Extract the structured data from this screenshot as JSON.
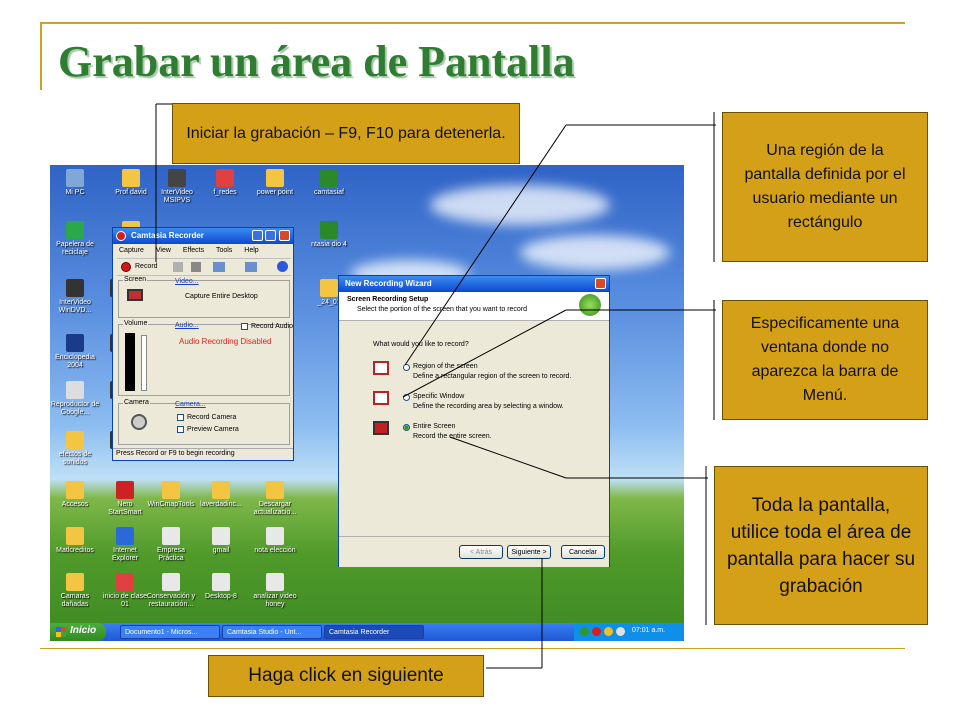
{
  "slide": {
    "title": "Grabar un área de Pantalla"
  },
  "callouts": {
    "start_recording": "Iniciar la grabación – F9, F10 para detenerla.",
    "region": "Una región de la pantalla definida por el usuario mediante un rectángulo",
    "window": "Especificamente una ventana donde no aparezca la barra de Menú.",
    "full_screen": "Toda la pantalla, utilice toda el área de pantalla para hacer su grabación",
    "click_next": "Haga click en siguiente"
  },
  "desktop_icons": [
    {
      "label": "Mi PC",
      "color": "#7fa7d8"
    },
    {
      "label": "Prof david",
      "color": "#f4c542"
    },
    {
      "label": "InterVideo MSIPVS",
      "color": "#444444"
    },
    {
      "label": "f_redes",
      "color": "#e04040"
    },
    {
      "label": "power point",
      "color": "#f4c542"
    },
    {
      "label": "camtasiaf",
      "color": "#2a8a2a"
    },
    {
      "label": "Papelera de reciclaje",
      "color": "#2aa84a"
    },
    {
      "label": "InterVideo WinDVD...",
      "color": "#333333"
    },
    {
      "label": "Enciclopedia 2004",
      "color": "#1a3a8a"
    },
    {
      "label": "Reproductor de Google...",
      "color": "#dddddd"
    },
    {
      "label": "efectos de sonidos",
      "color": "#f4c542"
    },
    {
      "label": "Accesos",
      "color": "#f4c542"
    },
    {
      "label": "Nero StartSmart",
      "color": "#cc2222"
    },
    {
      "label": "WinCmapTools",
      "color": "#f4c542"
    },
    {
      "label": "laverdadinc...",
      "color": "#f4c542"
    },
    {
      "label": "Descargar actualizacio...",
      "color": "#f4c542"
    },
    {
      "label": "Matlcreditos",
      "color": "#f4c542"
    },
    {
      "label": "Internet Explorer",
      "color": "#2a6ad8"
    },
    {
      "label": "Empresa Práctica",
      "color": "#e8e8e8"
    },
    {
      "label": "gmail",
      "color": "#e8e8e8"
    },
    {
      "label": "nota elección",
      "color": "#e8e8e8"
    },
    {
      "label": "Camaras dañadas",
      "color": "#f4c542"
    },
    {
      "label": "inicio de clase 01",
      "color": "#e04040"
    },
    {
      "label": "Conservación y restauración...",
      "color": "#e8e8e8"
    },
    {
      "label": "Desktop-8",
      "color": "#e8e8e8"
    },
    {
      "label": "analizar video honey",
      "color": "#e8e8e8"
    },
    {
      "label": "ntasia dio 4",
      "color": "#2a8a2a"
    },
    {
      "label": "_24_01",
      "color": "#f4c542"
    },
    {
      "label": "DVD",
      "color": "#333333"
    },
    {
      "label": "In Vi",
      "color": "#333333"
    },
    {
      "label": "Ne",
      "color": "#333333"
    },
    {
      "label": "f",
      "color": "#f4c542"
    },
    {
      "label": "A dir",
      "color": "#333333"
    }
  ],
  "recorder": {
    "title": "Camtasia Recorder",
    "menu": [
      "Capture",
      "View",
      "Effects",
      "Tools",
      "Help"
    ],
    "record_label": "Record",
    "screen_group": "Screen",
    "video_link": "Video...",
    "video_value": "Capture Entire Desktop",
    "volume_group": "Volume",
    "audio_link": "Audio...",
    "record_audio": "Record Audio",
    "audio_disabled": "Audio Recording Disabled",
    "camera_group": "Camera",
    "camera_link": "Camera...",
    "record_camera": "Record Camera",
    "preview_camera": "Preview Camera",
    "status": "Press Record or F9 to begin recording"
  },
  "wizard": {
    "title": "New Recording Wizard",
    "heading": "Screen Recording Setup",
    "subheading": "Select the portion of the screen that you want to record",
    "question": "What would you like to record?",
    "options": [
      {
        "label": "Region of the screen",
        "desc": "Define a rectangular region of the screen to record."
      },
      {
        "label": "Specific Window",
        "desc": "Define the recording area by selecting a window."
      },
      {
        "label": "Entire Screen",
        "desc": "Record the entire screen."
      }
    ],
    "back": "< Atrás",
    "next": "Siguiente >",
    "cancel": "Cancelar"
  },
  "taskbar": {
    "start": "Inicio",
    "tasks": [
      "Documento1 - Micros...",
      "Camtasia Studio - Unt...",
      "Camtasia Recorder"
    ],
    "clock": "07:01 a.m."
  },
  "colors": {
    "title_green": "#2e7d32",
    "callout_gold": "#d4a017",
    "frame_gold": "#c9a227"
  }
}
